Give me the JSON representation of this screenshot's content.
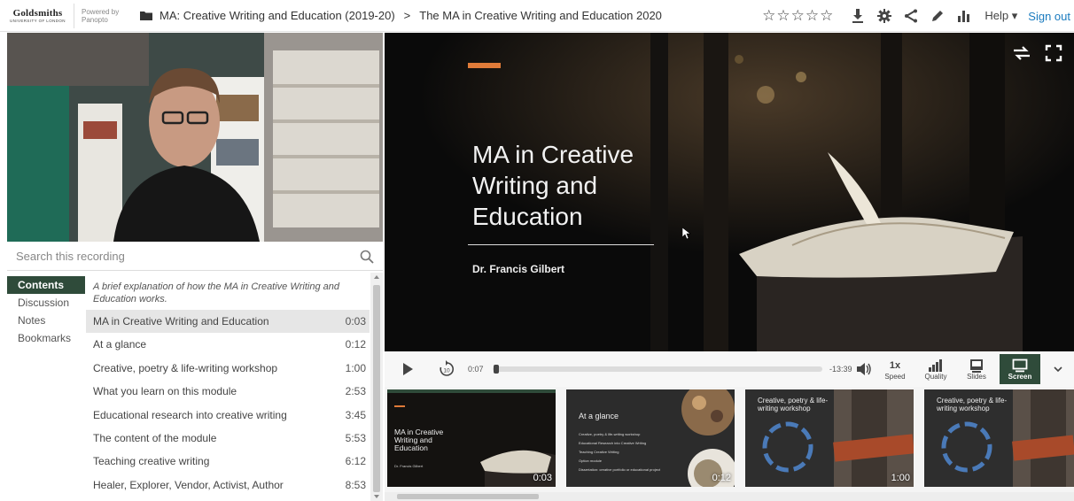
{
  "header": {
    "logo_main": "Goldsmiths",
    "logo_sub": "University of London",
    "powered_by": "Powered by Panopto",
    "breadcrumb_folder": "MA: Creative Writing and Education (2019-20)",
    "breadcrumb_separator": ">",
    "breadcrumb_session": "The MA in Creative Writing and Education 2020",
    "stars": [
      "☆",
      "☆",
      "☆",
      "☆",
      "☆"
    ],
    "help_label": "Help ▾",
    "signout_label": "Sign out",
    "icons": [
      "download-icon",
      "gear-icon",
      "share-icon",
      "edit-icon",
      "stats-icon"
    ]
  },
  "search": {
    "placeholder": "Search this recording"
  },
  "tabs": [
    {
      "label": "Contents",
      "active": true
    },
    {
      "label": "Discussion",
      "active": false
    },
    {
      "label": "Notes",
      "active": false
    },
    {
      "label": "Bookmarks",
      "active": false
    }
  ],
  "contents": {
    "description": "A brief explanation of how the MA in Creative Writing and Education works.",
    "items": [
      {
        "title": "MA in Creative Writing and Education",
        "time": "0:03",
        "selected": true
      },
      {
        "title": "At a glance",
        "time": "0:12"
      },
      {
        "title": "Creative, poetry & life-writing workshop",
        "time": "1:00"
      },
      {
        "title": "What you learn on this module",
        "time": "2:53"
      },
      {
        "title": "Educational research into creative writing",
        "time": "3:45"
      },
      {
        "title": "The content of the module",
        "time": "5:53"
      },
      {
        "title": "Teaching creative writing",
        "time": "6:12"
      },
      {
        "title": "Healer, Explorer, Vendor, Activist, Author",
        "time": "8:53"
      }
    ]
  },
  "slide": {
    "title": "MA in Creative Writing and Education",
    "author": "Dr. Francis Gilbert",
    "accent_color": "#e07b39"
  },
  "controls": {
    "current_time": "0:07",
    "remaining_time": "-13:39",
    "progress": 0.01,
    "speed_value": "1x",
    "speed_label": "Speed",
    "quality_label": "Quality",
    "slides_label": "Slides",
    "screen_label": "Screen"
  },
  "thumbnails": [
    {
      "title": "MA in Creative Writing and Education",
      "subtitle": "Dr. Francis Gilbert",
      "time": "0:03",
      "active": true
    },
    {
      "title": "At a glance",
      "lines": [
        "Creative, poetry & life-writing workshop",
        "Educational Research into Creative Writing",
        "Teaching Creative Writing",
        "Option module",
        "Dissertation: creative portfolio or educational project"
      ],
      "time": "0:12"
    },
    {
      "title": "Creative, poetry & life-writing workshop",
      "time": "1:00"
    },
    {
      "title": "Creative, poetry & life-writing workshop",
      "time": ""
    }
  ],
  "colors": {
    "brand_green": "#2f4b3a",
    "link_blue": "#1a7bbf"
  }
}
